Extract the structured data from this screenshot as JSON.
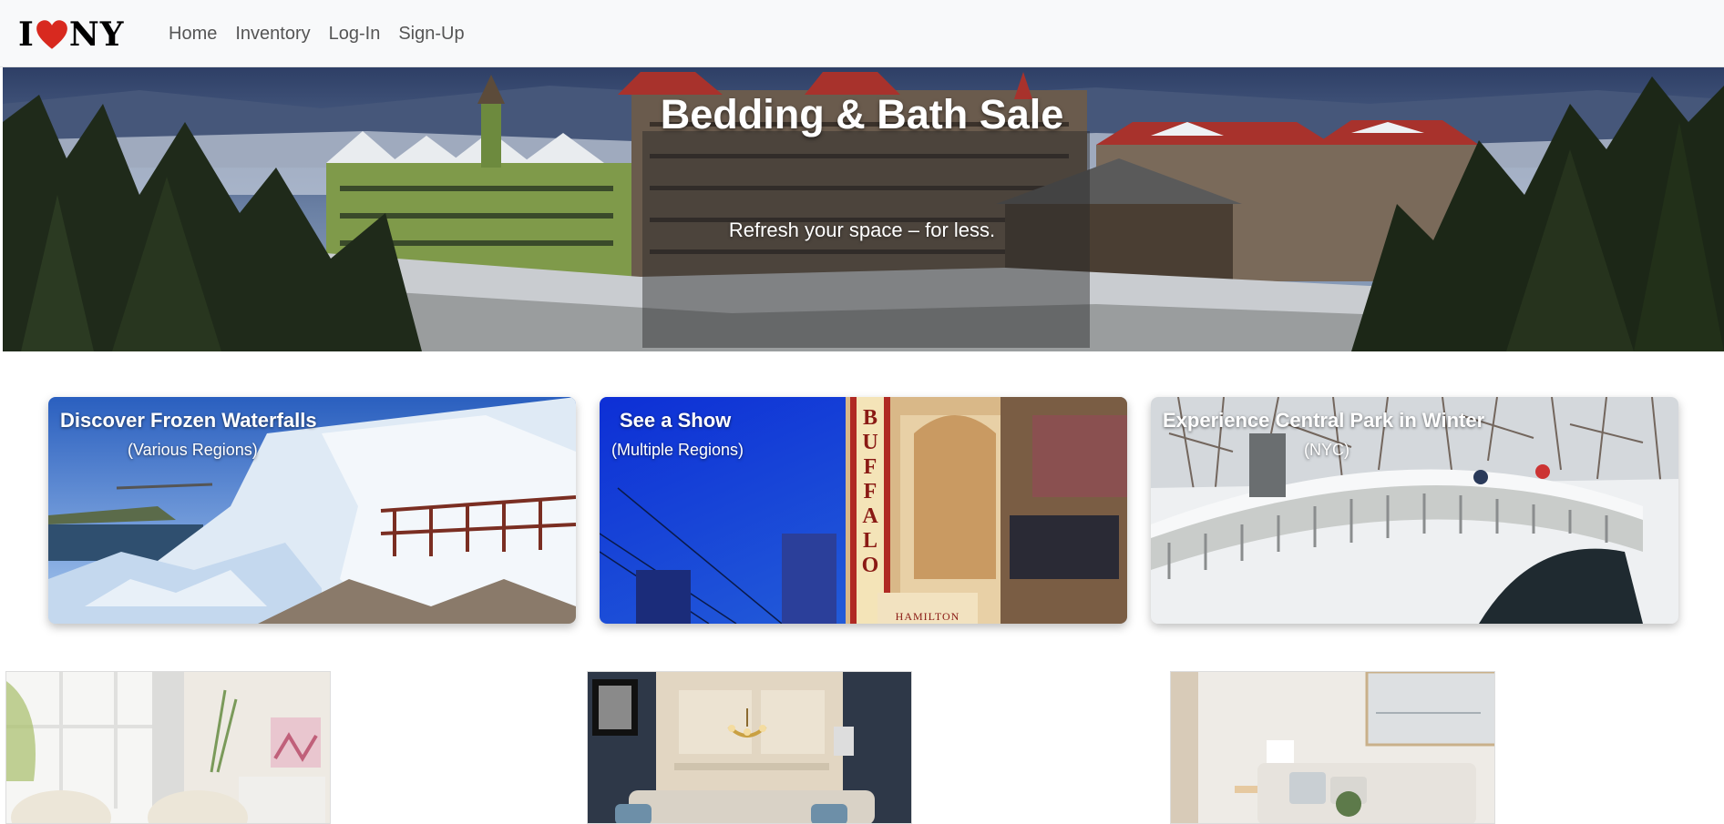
{
  "navbar": {
    "logo": {
      "left": "I",
      "right": "NY",
      "heart_color": "#d8291f"
    },
    "links": [
      "Home",
      "Inventory",
      "Log-In",
      "Sign-Up"
    ]
  },
  "hero": {
    "title": "Bedding & Bath Sale",
    "subtitle": "Refresh your space – for less."
  },
  "cards": [
    {
      "title": "Discover Frozen Waterfalls",
      "subtitle": "(Various Regions)"
    },
    {
      "title": "See a Show",
      "subtitle": "(Multiple Regions)",
      "sign_letters": "BUFFALO",
      "marquee": "HAMILTON"
    },
    {
      "title": "Experience Central Park in Winter",
      "subtitle": "(NYC)"
    }
  ],
  "colors": {
    "navbar_bg": "#f8f9fa",
    "nav_link": "#555555",
    "heart": "#d8291f"
  }
}
